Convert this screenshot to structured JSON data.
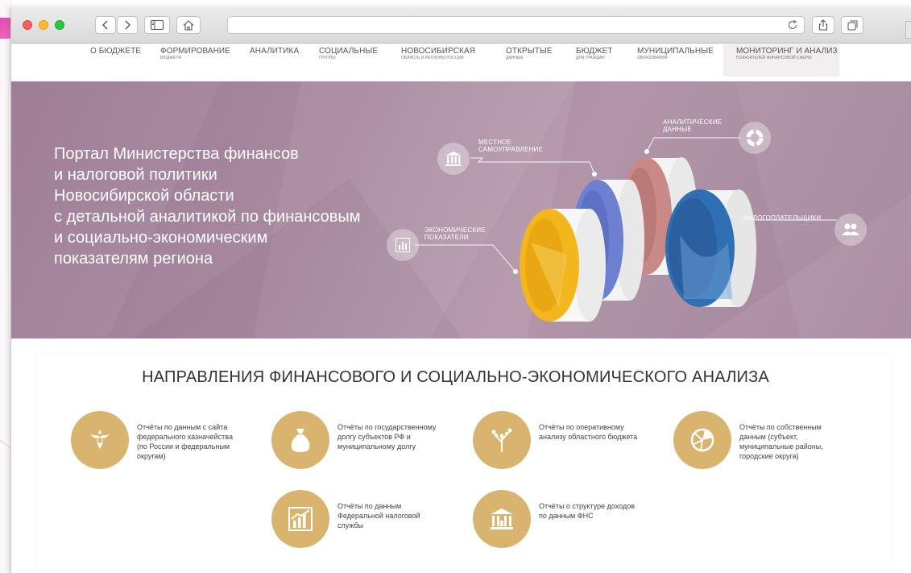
{
  "browser": {
    "controls": [
      "back",
      "forward",
      "sidebar",
      "home"
    ],
    "address": ""
  },
  "nav": [
    {
      "label": "О БЮДЖЕТЕ",
      "sub": ""
    },
    {
      "label": "ФОРМИРОВАНИЕ",
      "sub": "БЮДЖЕТА"
    },
    {
      "label": "АНАЛИТИКА",
      "sub": ""
    },
    {
      "label": "СОЦИАЛЬНЫЕ",
      "sub": "ГРУППЫ"
    },
    {
      "label": "НОВОСИБИРСКАЯ",
      "sub": "ОБЛАСТЬ И РЕГИОНЫ РОССИИ"
    },
    {
      "label": "ОТКРЫТЫЕ",
      "sub": "ДАННЫЕ"
    },
    {
      "label": "БЮДЖЕТ",
      "sub": "ДЛЯ ГРАЖДАН"
    },
    {
      "label": "МУНИЦИПАЛЬНЫЕ",
      "sub": "ОБРАЗОВАНИЯ"
    },
    {
      "label": "МОНИТОРИНГ И АНАЛИЗ",
      "sub": "ПОКАЗАТЕЛЕЙ ФИНАНСОВОЙ СФЕРЫ"
    }
  ],
  "hero": {
    "lines": [
      "Портал Министерства финансов",
      "и налоговой политики",
      "Новосибирской области",
      "с детальной аналитикой по финансовым",
      "и социально-экономическим",
      "показателям региона"
    ],
    "callouts": {
      "local": [
        "МЕСТНОЕ",
        "САМОУПРАВЛЕНИЕ"
      ],
      "analytic": [
        "АНАЛИТИЧЕСКИЕ",
        "ДАННЫЕ"
      ],
      "economic": [
        "ЭКОНОМИЧЕСКИЕ",
        "ПОКАЗАТЕЛИ"
      ],
      "taxpayers": [
        "НАЛОГОПЛАТЕЛЬЩИКИ"
      ]
    }
  },
  "section": {
    "title": "НАПРАВЛЕНИЯ ФИНАНСОВОГО И СОЦИАЛЬНО-ЭКОНОМИЧЕСКОГО АНАЛИЗА",
    "reports": [
      {
        "icon": "emblem-icon",
        "lines": [
          "Отчёты по данным с сайта",
          "федерального казначейства",
          "(по России и федеральным",
          "округам)"
        ]
      },
      {
        "icon": "money-bag-icon",
        "lines": [
          "Отчёты по государственному",
          "долгу субъектов РФ и",
          "муниципальному долгу"
        ]
      },
      {
        "icon": "tree-icon",
        "lines": [
          "Отчёты по оперативному",
          "анализу областного бюджета"
        ]
      },
      {
        "icon": "pie-chart-icon",
        "lines": [
          "Отчёты по собственным",
          "данным (субъект,",
          "муниципальные районы,",
          "городские округа)"
        ]
      },
      {
        "icon": "bar-chart-icon",
        "lines": [
          "Отчёты по данным",
          "Федеральной налоговой",
          "службы"
        ]
      },
      {
        "icon": "building-icon",
        "lines": [
          "Отчёты о структуре доходов",
          "по данным ФНС"
        ]
      }
    ]
  },
  "colors": {
    "accent": "#d9b46e",
    "hero": "#a98aa0",
    "yellow": "#f2b71d",
    "blue": "#6d7fd0",
    "pink": "#d08c86",
    "navy": "#2f6fb3"
  }
}
